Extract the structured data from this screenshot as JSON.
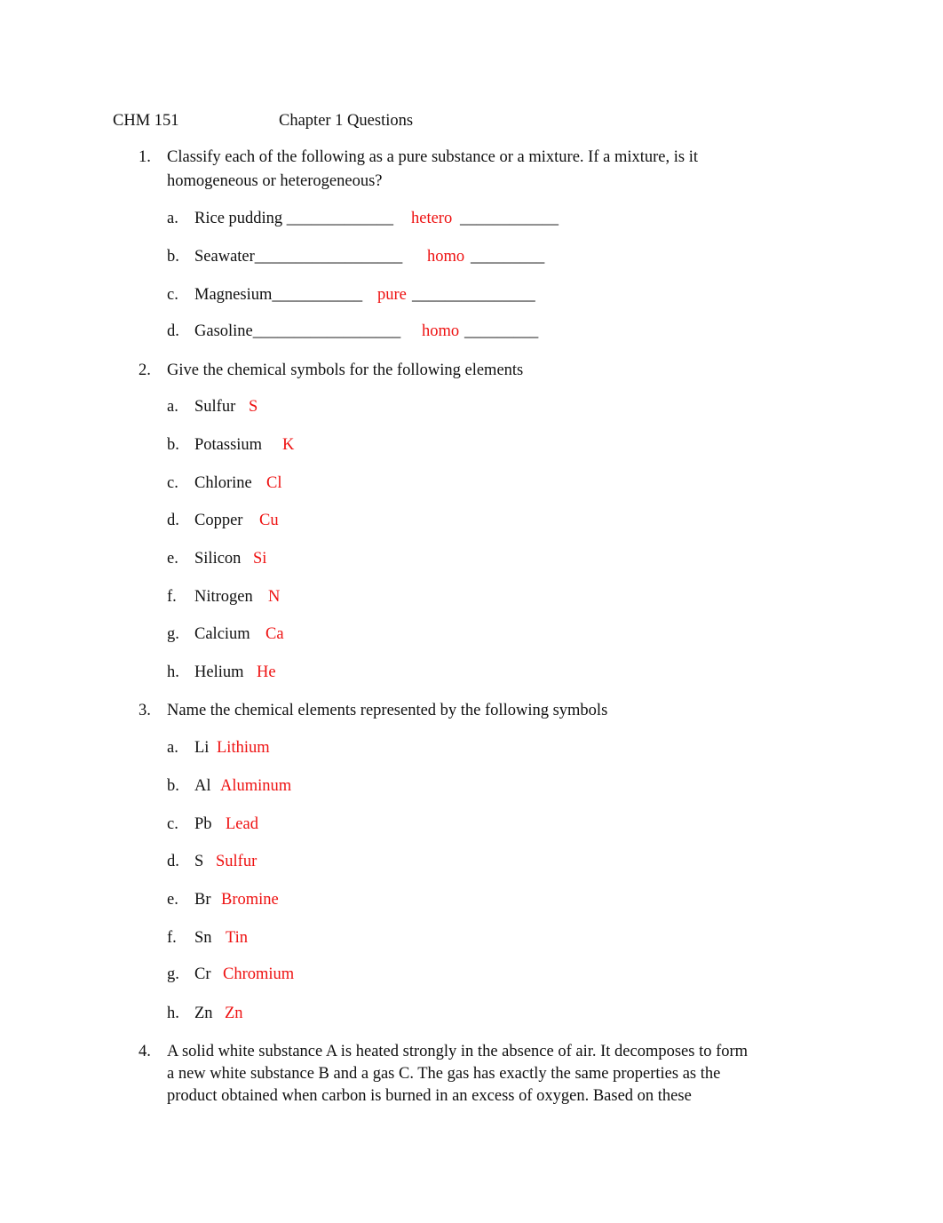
{
  "header": {
    "course": "CHM 151",
    "title": "Chapter 1 Questions"
  },
  "questions": [
    {
      "number": "1.",
      "text_lines": [
        "Classify each of the following as a pure substance or a mixture. If a mixture, is it",
        "homogeneous or heterogeneous?"
      ],
      "items": [
        {
          "letter": "a.",
          "prompt": "Rice pudding _____________",
          "answer": "hetero",
          "trailing": "____________"
        },
        {
          "letter": "b.",
          "prompt": "Seawater__________________",
          "answer": "homo",
          "trailing": "_________"
        },
        {
          "letter": "c.",
          "prompt": "Magnesium___________",
          "answer": "pure",
          "trailing": "_______________"
        },
        {
          "letter": "d.",
          "prompt": "Gasoline__________________",
          "answer": "homo",
          "trailing": "_________"
        }
      ]
    },
    {
      "number": "2.",
      "text_lines": [
        "Give the chemical symbols for the following elements"
      ],
      "items": [
        {
          "letter": "a.",
          "prompt": "Sulfur",
          "answer": "S"
        },
        {
          "letter": "b.",
          "prompt": "Potassium",
          "answer": "K"
        },
        {
          "letter": "c.",
          "prompt": "Chlorine",
          "answer": "Cl"
        },
        {
          "letter": "d.",
          "prompt": "Copper",
          "answer": "Cu"
        },
        {
          "letter": "e.",
          "prompt": "Silicon",
          "answer": "Si"
        },
        {
          "letter": "f.",
          "prompt": "Nitrogen",
          "answer": "N"
        },
        {
          "letter": "g.",
          "prompt": "Calcium",
          "answer": "Ca"
        },
        {
          "letter": "h.",
          "prompt": "Helium",
          "answer": "He"
        }
      ]
    },
    {
      "number": "3.",
      "text_lines": [
        "Name the chemical elements represented by the following symbols"
      ],
      "items": [
        {
          "letter": "a.",
          "prompt": "Li",
          "answer": "Lithium"
        },
        {
          "letter": "b.",
          "prompt": "Al",
          "answer": "Aluminum"
        },
        {
          "letter": "c.",
          "prompt": "Pb",
          "answer": "Lead"
        },
        {
          "letter": "d.",
          "prompt": "S",
          "answer": "Sulfur"
        },
        {
          "letter": "e.",
          "prompt": "Br",
          "answer": "Bromine"
        },
        {
          "letter": "f.",
          "prompt": "Sn",
          "answer": "Tin"
        },
        {
          "letter": "g.",
          "prompt": "Cr",
          "answer": "Chromium"
        },
        {
          "letter": "h.",
          "prompt": "Zn",
          "answer": "Zn"
        }
      ]
    },
    {
      "number": "4.",
      "text_lines": [
        "A solid white substance A is heated strongly in the absence of air. It decomposes to form",
        "a new white substance B and a gas C. The gas has exactly the same properties as the",
        "product obtained when carbon is burned in an excess of oxygen. Based on these"
      ],
      "items": []
    }
  ],
  "colors": {
    "answer": "#ee1111",
    "text": "#111111"
  }
}
